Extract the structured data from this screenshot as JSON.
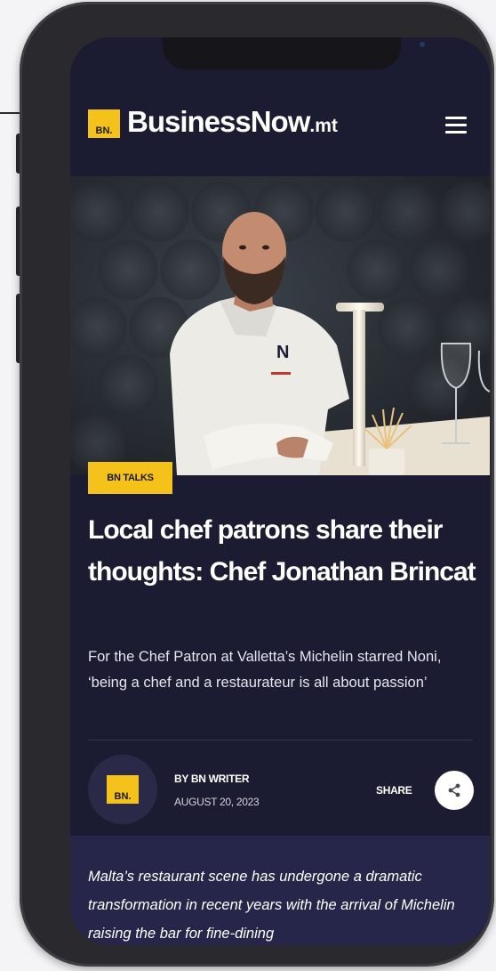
{
  "site": {
    "logo_badge": "BN.",
    "logo_name": "BusinessNow",
    "logo_suffix": ".mt",
    "menu_icon": "hamburger-menu-icon"
  },
  "article": {
    "category_tag": "BN TALKS",
    "headline": "Local chef patrons share their thoughts: Chef Jonathan Brincat",
    "subtitle": "For the Chef Patron at Valletta’s Michelin starred Noni, ‘being a chef and a restaurateur is all about passion’",
    "author": {
      "avatar_badge": "BN.",
      "byline": "BY BN WRITER",
      "date": "AUGUST 20, 2023"
    },
    "share": {
      "label": "SHARE",
      "icon": "share-icon"
    },
    "body_intro": "Malta’s restaurant scene has undergone a dramatic transformation in recent years with the arrival of Michelin raising the bar for fine-dining"
  },
  "colors": {
    "accent_yellow": "#f4c21a",
    "background_navy": "#1b1b31",
    "body_section": "#26264a"
  }
}
